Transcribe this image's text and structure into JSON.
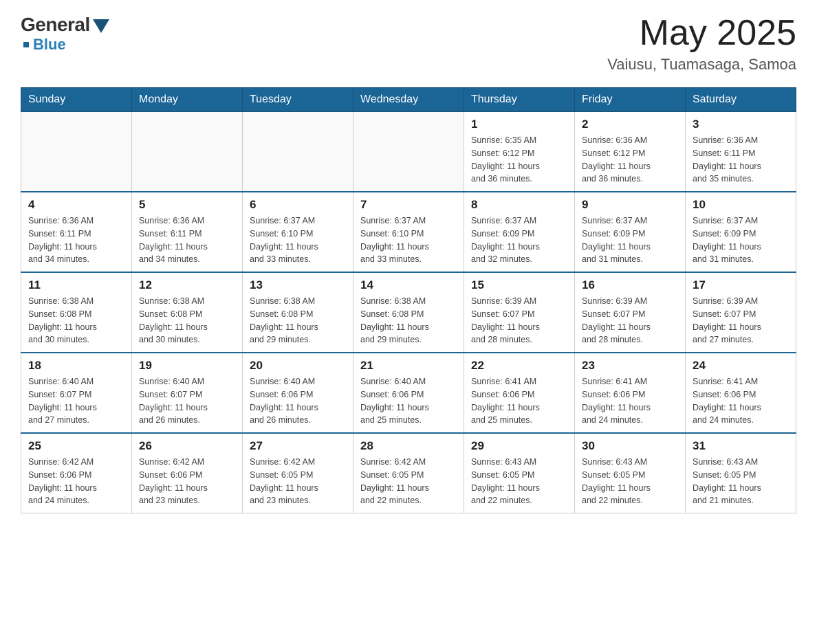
{
  "header": {
    "logo": {
      "general": "General",
      "blue": "Blue",
      "tagline": "Blue"
    },
    "month": "May 2025",
    "location": "Vaiusu, Tuamasaga, Samoa"
  },
  "weekdays": [
    "Sunday",
    "Monday",
    "Tuesday",
    "Wednesday",
    "Thursday",
    "Friday",
    "Saturday"
  ],
  "weeks": [
    [
      {
        "day": "",
        "info": ""
      },
      {
        "day": "",
        "info": ""
      },
      {
        "day": "",
        "info": ""
      },
      {
        "day": "",
        "info": ""
      },
      {
        "day": "1",
        "info": "Sunrise: 6:35 AM\nSunset: 6:12 PM\nDaylight: 11 hours\nand 36 minutes."
      },
      {
        "day": "2",
        "info": "Sunrise: 6:36 AM\nSunset: 6:12 PM\nDaylight: 11 hours\nand 36 minutes."
      },
      {
        "day": "3",
        "info": "Sunrise: 6:36 AM\nSunset: 6:11 PM\nDaylight: 11 hours\nand 35 minutes."
      }
    ],
    [
      {
        "day": "4",
        "info": "Sunrise: 6:36 AM\nSunset: 6:11 PM\nDaylight: 11 hours\nand 34 minutes."
      },
      {
        "day": "5",
        "info": "Sunrise: 6:36 AM\nSunset: 6:11 PM\nDaylight: 11 hours\nand 34 minutes."
      },
      {
        "day": "6",
        "info": "Sunrise: 6:37 AM\nSunset: 6:10 PM\nDaylight: 11 hours\nand 33 minutes."
      },
      {
        "day": "7",
        "info": "Sunrise: 6:37 AM\nSunset: 6:10 PM\nDaylight: 11 hours\nand 33 minutes."
      },
      {
        "day": "8",
        "info": "Sunrise: 6:37 AM\nSunset: 6:09 PM\nDaylight: 11 hours\nand 32 minutes."
      },
      {
        "day": "9",
        "info": "Sunrise: 6:37 AM\nSunset: 6:09 PM\nDaylight: 11 hours\nand 31 minutes."
      },
      {
        "day": "10",
        "info": "Sunrise: 6:37 AM\nSunset: 6:09 PM\nDaylight: 11 hours\nand 31 minutes."
      }
    ],
    [
      {
        "day": "11",
        "info": "Sunrise: 6:38 AM\nSunset: 6:08 PM\nDaylight: 11 hours\nand 30 minutes."
      },
      {
        "day": "12",
        "info": "Sunrise: 6:38 AM\nSunset: 6:08 PM\nDaylight: 11 hours\nand 30 minutes."
      },
      {
        "day": "13",
        "info": "Sunrise: 6:38 AM\nSunset: 6:08 PM\nDaylight: 11 hours\nand 29 minutes."
      },
      {
        "day": "14",
        "info": "Sunrise: 6:38 AM\nSunset: 6:08 PM\nDaylight: 11 hours\nand 29 minutes."
      },
      {
        "day": "15",
        "info": "Sunrise: 6:39 AM\nSunset: 6:07 PM\nDaylight: 11 hours\nand 28 minutes."
      },
      {
        "day": "16",
        "info": "Sunrise: 6:39 AM\nSunset: 6:07 PM\nDaylight: 11 hours\nand 28 minutes."
      },
      {
        "day": "17",
        "info": "Sunrise: 6:39 AM\nSunset: 6:07 PM\nDaylight: 11 hours\nand 27 minutes."
      }
    ],
    [
      {
        "day": "18",
        "info": "Sunrise: 6:40 AM\nSunset: 6:07 PM\nDaylight: 11 hours\nand 27 minutes."
      },
      {
        "day": "19",
        "info": "Sunrise: 6:40 AM\nSunset: 6:07 PM\nDaylight: 11 hours\nand 26 minutes."
      },
      {
        "day": "20",
        "info": "Sunrise: 6:40 AM\nSunset: 6:06 PM\nDaylight: 11 hours\nand 26 minutes."
      },
      {
        "day": "21",
        "info": "Sunrise: 6:40 AM\nSunset: 6:06 PM\nDaylight: 11 hours\nand 25 minutes."
      },
      {
        "day": "22",
        "info": "Sunrise: 6:41 AM\nSunset: 6:06 PM\nDaylight: 11 hours\nand 25 minutes."
      },
      {
        "day": "23",
        "info": "Sunrise: 6:41 AM\nSunset: 6:06 PM\nDaylight: 11 hours\nand 24 minutes."
      },
      {
        "day": "24",
        "info": "Sunrise: 6:41 AM\nSunset: 6:06 PM\nDaylight: 11 hours\nand 24 minutes."
      }
    ],
    [
      {
        "day": "25",
        "info": "Sunrise: 6:42 AM\nSunset: 6:06 PM\nDaylight: 11 hours\nand 24 minutes."
      },
      {
        "day": "26",
        "info": "Sunrise: 6:42 AM\nSunset: 6:06 PM\nDaylight: 11 hours\nand 23 minutes."
      },
      {
        "day": "27",
        "info": "Sunrise: 6:42 AM\nSunset: 6:05 PM\nDaylight: 11 hours\nand 23 minutes."
      },
      {
        "day": "28",
        "info": "Sunrise: 6:42 AM\nSunset: 6:05 PM\nDaylight: 11 hours\nand 22 minutes."
      },
      {
        "day": "29",
        "info": "Sunrise: 6:43 AM\nSunset: 6:05 PM\nDaylight: 11 hours\nand 22 minutes."
      },
      {
        "day": "30",
        "info": "Sunrise: 6:43 AM\nSunset: 6:05 PM\nDaylight: 11 hours\nand 22 minutes."
      },
      {
        "day": "31",
        "info": "Sunrise: 6:43 AM\nSunset: 6:05 PM\nDaylight: 11 hours\nand 21 minutes."
      }
    ]
  ]
}
